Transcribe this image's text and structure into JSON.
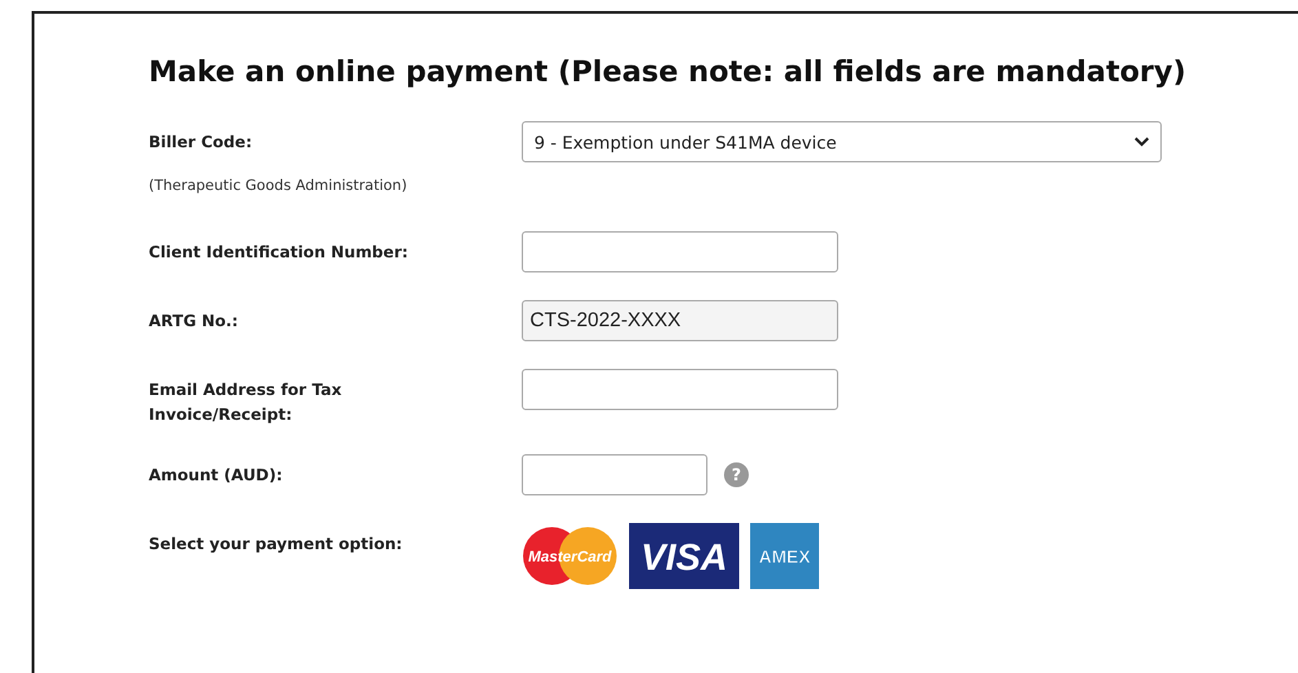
{
  "title": "Make an online payment (Please note: all fields are mandatory)",
  "rows": [
    {
      "kind": "select",
      "label": "Biller Code:",
      "sublabel": "(Therapeutic Goods Administration)",
      "value": "9 - Exemption under S41MA device"
    },
    {
      "kind": "text",
      "label": "Client Identification Number:"
    },
    {
      "kind": "text",
      "label": "ARTG No.:",
      "value": "CTS-2022-XXXX"
    },
    {
      "kind": "text",
      "label": "Email Address for Tax Invoice/Receipt:"
    },
    {
      "kind": "amount",
      "label": "Amount (AUD):",
      "help": "?"
    },
    {
      "kind": "cards",
      "label": "Select your payment option:",
      "cards": [
        {
          "kind": "mastercard",
          "text": "MasterCard"
        },
        {
          "kind": "visa",
          "text": "VISA"
        },
        {
          "kind": "amex",
          "text": "AMEX"
        }
      ]
    }
  ]
}
